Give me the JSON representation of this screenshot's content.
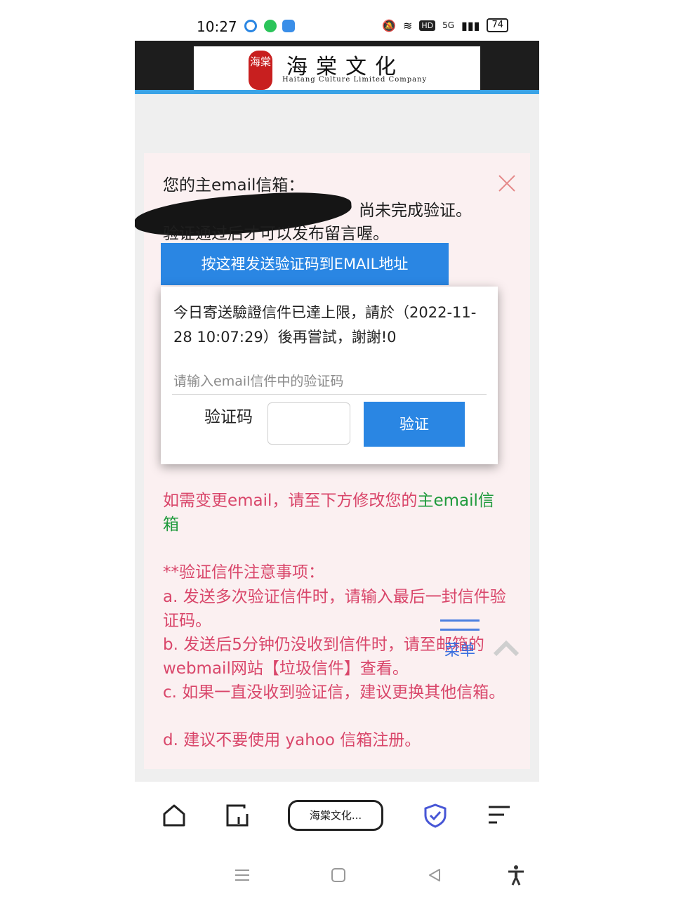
{
  "status": {
    "time": "10:27",
    "battery": "74",
    "network": "5G",
    "hd": "HD"
  },
  "header": {
    "logo_seal": "海棠",
    "logo_title": "海棠文化",
    "logo_subtitle": "Haitang Culture Limited Company"
  },
  "card": {
    "line1": "您的主email信箱：",
    "line2_suffix": "尚未完成验证。",
    "line3": "验证通过后才可以发布留言喔。",
    "send_button": "按这裡发送验证码到EMAIL地址"
  },
  "dialog": {
    "message": "今日寄送驗證信件已達上限，請於（2022-11-28 10:07:29）後再嘗試，謝謝!0",
    "input_placeholder": "请输入email信件中的验证码",
    "code_label": "验证码",
    "code_value": "",
    "verify_button": "验证"
  },
  "notes": {
    "change_email_pre": "如需变更email，请至下方修改您的",
    "change_email_link": "主email",
    "change_email_post": "信箱",
    "heading": "**验证信件注意事项：",
    "item_a": "a. 发送多次验证信件时，请输入最后一封信件验证码。",
    "item_b": "b. 发送后5分钟仍没收到信件时，请至邮箱的webmail网站【垃圾信件】查看。",
    "item_c": "c. 如果一直没收到验证信，建议更换其他信箱。",
    "item_d": "d. 建议不要使用 yahoo 信箱注册。"
  },
  "floating_menu": {
    "label": "菜单"
  },
  "toolbar": {
    "url_label": "海棠文化..."
  },
  "colors": {
    "accent_blue": "#2a86e3",
    "note_pink": "#d9466a",
    "card_bg": "#fbf0f1",
    "header_bar": "#3aa3e6"
  },
  "icons": [
    "home-icon",
    "tabs-icon",
    "shield-check-icon",
    "menu-icon",
    "close-icon",
    "chevron-up-icon",
    "recent-apps-icon",
    "home-square-icon",
    "back-icon",
    "accessibility-icon"
  ]
}
